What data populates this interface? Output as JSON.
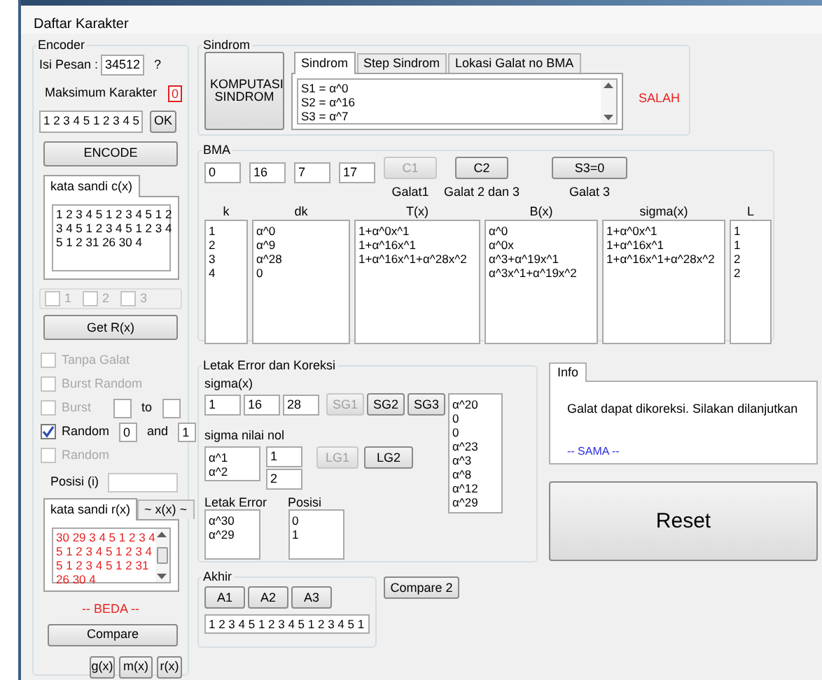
{
  "window": {
    "title": "Daftar Karakter"
  },
  "encoder": {
    "title": "Encoder",
    "message_label": "Isi Pesan :",
    "message_value": "34512",
    "help": "?",
    "max_label": "Maksimum Karakter",
    "max_value": "0",
    "code_value": "1 2 3 4 5 1 2 3 4 5",
    "ok_button": "OK",
    "encode_button": "ENCODE",
    "codeword_tabs": [
      {
        "label": "kata sandi c(x)",
        "selected": true
      }
    ],
    "codeword_lines": [
      "1 2 3 4 5 1 2 3 4 5 1 2",
      "3 4 5 1 2 3 4 5 1 2 3 4",
      "5 1 2 31 26 30 4"
    ],
    "error_count": [
      {
        "label": "1",
        "checked": false,
        "disabled": true
      },
      {
        "label": "2",
        "checked": false,
        "disabled": true
      },
      {
        "label": "3",
        "checked": false,
        "disabled": true
      }
    ],
    "get_button": "Get R(x)",
    "options": [
      {
        "kind": "check",
        "label": "Tanpa Galat",
        "checked": false,
        "disabled": true
      },
      {
        "kind": "check",
        "label": "Burst Random",
        "checked": false,
        "disabled": true
      },
      {
        "kind": "range",
        "label": "Burst",
        "checked": false,
        "disabled": true,
        "joiner": "to"
      },
      {
        "kind": "range",
        "label": "Random",
        "checked": true,
        "disabled": false,
        "joiner": "and",
        "from": "0",
        "to": "1"
      },
      {
        "kind": "check",
        "label": "Random",
        "checked": false,
        "disabled": true
      }
    ],
    "position_label": "Posisi (i)",
    "received_tabs": [
      {
        "label": "kata sandi r(x)",
        "selected": true
      },
      {
        "label": "~ x(x) ~",
        "selected": false
      }
    ],
    "received_lines": [
      "30 29 3 4 5 1 2 3 4",
      "5 1 2 3 4 5 1 2 3 4",
      "5 1 2 3 4 5 1 2 31",
      "26 30 4"
    ],
    "result": "-- BEDA --",
    "compare_button": "Compare",
    "poly_buttons": [
      "g(x)",
      "m(x)",
      "r(x)"
    ]
  },
  "sindrom": {
    "title": "Sindrom",
    "compute_button": "KOMPUTASI SINDROM",
    "tabs": [
      {
        "label": "Sindrom",
        "selected": true
      },
      {
        "label": "Step Sindrom",
        "selected": false
      },
      {
        "label": "Lokasi Galat no BMA",
        "selected": false
      }
    ],
    "lines": [
      "S1 = α^0",
      "S2 = α^16",
      "S3 = α^7"
    ],
    "status": "SALAH"
  },
  "bma": {
    "title": "BMA",
    "inputs": [
      "0",
      "16",
      "7",
      "17"
    ],
    "buttons": [
      {
        "label": "C1",
        "disabled": true,
        "caption": "Galat1"
      },
      {
        "label": "C2",
        "disabled": false,
        "caption": "Galat 2 dan 3"
      },
      {
        "label": "S3=0",
        "disabled": false,
        "caption": "Galat 3"
      }
    ],
    "columns": [
      {
        "header": "k",
        "lines": [
          "1",
          "2",
          "3",
          "4"
        ]
      },
      {
        "header": "dk",
        "lines": [
          "α^0",
          "α^9",
          "α^28",
          "0"
        ]
      },
      {
        "header": "T(x)",
        "lines": [
          "1+α^0x^1",
          "1+α^16x^1",
          "1+α^16x^1+α^28x^2"
        ]
      },
      {
        "header": "B(x)",
        "lines": [
          "α^0",
          "α^0x",
          "α^3+α^19x^1",
          "α^3x^1+α^19x^2"
        ]
      },
      {
        "header": "sigma(x)",
        "lines": [
          "1+α^0x^1",
          "1+α^16x^1",
          "1+α^16x^1+α^28x^2"
        ]
      },
      {
        "header": "L",
        "lines": [
          "1",
          "1",
          "2",
          "2"
        ]
      }
    ]
  },
  "correction": {
    "title": "Letak Error dan Koreksi",
    "sigma_label": "sigma(x)",
    "sigma_inputs": [
      "1",
      "16",
      "28"
    ],
    "sigma_buttons": [
      {
        "label": "SG1",
        "disabled": true
      },
      {
        "label": "SG2",
        "disabled": false
      },
      {
        "label": "SG3",
        "disabled": false
      }
    ],
    "roots": [
      "α^20",
      "0",
      "0",
      "α^23",
      "α^3",
      "α^8",
      "α^12",
      "α^29"
    ],
    "zero_label": "sigma nilai nol",
    "zero_list": [
      "α^1",
      "α^2"
    ],
    "zero_inputs": [
      "1",
      "2"
    ],
    "zero_buttons": [
      {
        "label": "LG1",
        "disabled": true
      },
      {
        "label": "LG2",
        "disabled": false
      }
    ],
    "error_label": "Letak Error",
    "error_list": [
      "α^30",
      "α^29"
    ],
    "position_label": "Posisi",
    "position_list": [
      "0",
      "1"
    ]
  },
  "final": {
    "title": "Akhir",
    "buttons": [
      "A1",
      "A2",
      "A3"
    ],
    "output": "1 2 3 4 5 1 2 3 4 5 1 2 3 4 5 1"
  },
  "compare2_button": "Compare 2",
  "info": {
    "tab": "Info",
    "message": "Galat dapat dikoreksi. Silakan dilanjutkan",
    "status": "-- SAMA --"
  },
  "reset_button": "Reset"
}
